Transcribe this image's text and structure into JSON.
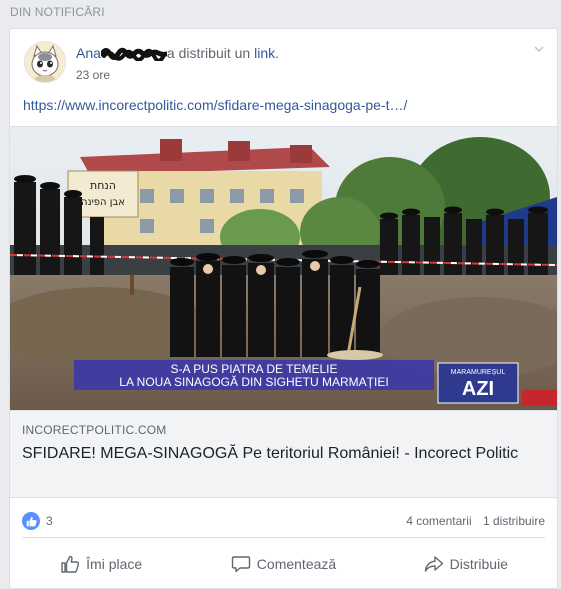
{
  "section": {
    "header": "DIN NOTIFICĂRI"
  },
  "post": {
    "author_visible": "Ana",
    "action_prefix": "a distribuit un",
    "action_link": "link",
    "action_suffix": ".",
    "timestamp": "23 ore",
    "url": "https://www.incorectpolitic.com/sfidare-mega-sinagoga-pe-t…/",
    "menu_icon": "chevron-down-icon"
  },
  "preview": {
    "banner_sign_line1": "הנחת",
    "banner_sign_line2": "אבן הפינה",
    "caption_line1": "S-A PUS PIATRA DE TEMELIE",
    "caption_line2": "LA NOUA SINAGOGĂ DIN SIGHETU MARMAȚIEI",
    "logo_line1": "MARAMUREȘUL",
    "logo_line2": "AZI"
  },
  "link_preview": {
    "domain": "INCORECTPOLITIC.COM",
    "title": "SFIDARE! MEGA-SINAGOGĂ Pe teritoriul României! - Incorect Politic"
  },
  "stats": {
    "reaction_count": "3",
    "comments": "4 comentarii",
    "shares": "1 distribuire"
  },
  "actions": {
    "like": "Îmi place",
    "comment": "Comentează",
    "share": "Distribuie"
  },
  "colors": {
    "link": "#365899",
    "like_blue": "#5890ff",
    "caption_bar": "#3d3aa6"
  }
}
